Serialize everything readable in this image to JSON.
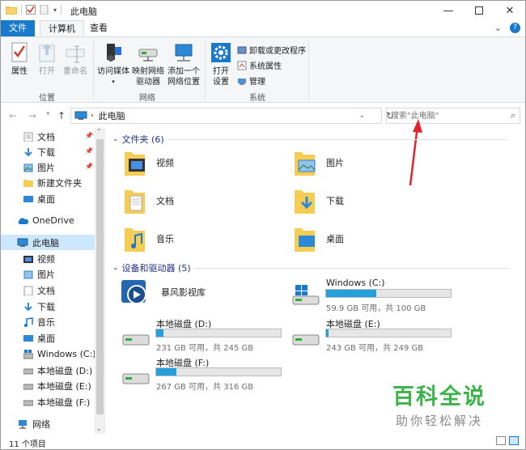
{
  "window": {
    "title": "此电脑"
  },
  "menu_tabs": {
    "file": "文件",
    "computer": "计算机",
    "view": "查看"
  },
  "ribbon": {
    "location_group": "位置",
    "network_group": "网络",
    "system_group": "系统",
    "properties": "属性",
    "open": "打开",
    "rename": "重命名",
    "access_media": "访问媒体",
    "map_drive_1": "映射网络",
    "map_drive_2": "驱动器",
    "add_location_1": "添加一个",
    "add_location_2": "网络位置",
    "open_settings_1": "打开",
    "open_settings_2": "设置",
    "uninstall": "卸载或更改程序",
    "system_props": "系统属性",
    "manage": "管理"
  },
  "address": {
    "path": "此电脑",
    "search_placeholder": "搜索\"此电脑\""
  },
  "sidebar": {
    "quick": [
      {
        "label": "文档",
        "pinned": true
      },
      {
        "label": "下载",
        "pinned": true
      },
      {
        "label": "图片",
        "pinned": true
      },
      {
        "label": "新建文件夹",
        "pinned": false
      },
      {
        "label": "桌面",
        "pinned": false
      }
    ],
    "onedrive": "OneDrive",
    "this_pc": "此电脑",
    "pc_items": [
      "视频",
      "图片",
      "文档",
      "下载",
      "音乐",
      "桌面",
      "Windows (C:)",
      "本地磁盘 (D:)",
      "本地磁盘 (E:)",
      "本地磁盘 (F:)"
    ],
    "network": "网络"
  },
  "content": {
    "folders_header": "文件夹 (6)",
    "folders": [
      "视频",
      "图片",
      "文档",
      "下载",
      "音乐",
      "桌面"
    ],
    "devices_header": "设备和驱动器 (5)",
    "storm": "暴风影视库",
    "drives": [
      {
        "name": "Windows (C:)",
        "info": "59.9 GB 可用，共 100 GB",
        "used_fraction": 0.4
      },
      {
        "name": "本地磁盘 (D:)",
        "info": "231 GB 可用，共 245 GB",
        "used_fraction": 0.06
      },
      {
        "name": "本地磁盘 (E:)",
        "info": "243 GB 可用，共 249 GB",
        "used_fraction": 0.02
      },
      {
        "name": "本地磁盘 (F:)",
        "info": "267 GB 可用，共 316 GB",
        "used_fraction": 0.16
      }
    ]
  },
  "status": {
    "count": "11 个项目"
  },
  "watermark": {
    "big": "百科全说",
    "small": "助你轻松解决"
  },
  "colors": {
    "accent": "#1979ca",
    "drive_fill": "#26a0da",
    "selection": "#cce8ff",
    "watermark": "#3db34a",
    "arrow": "#e0242b"
  }
}
